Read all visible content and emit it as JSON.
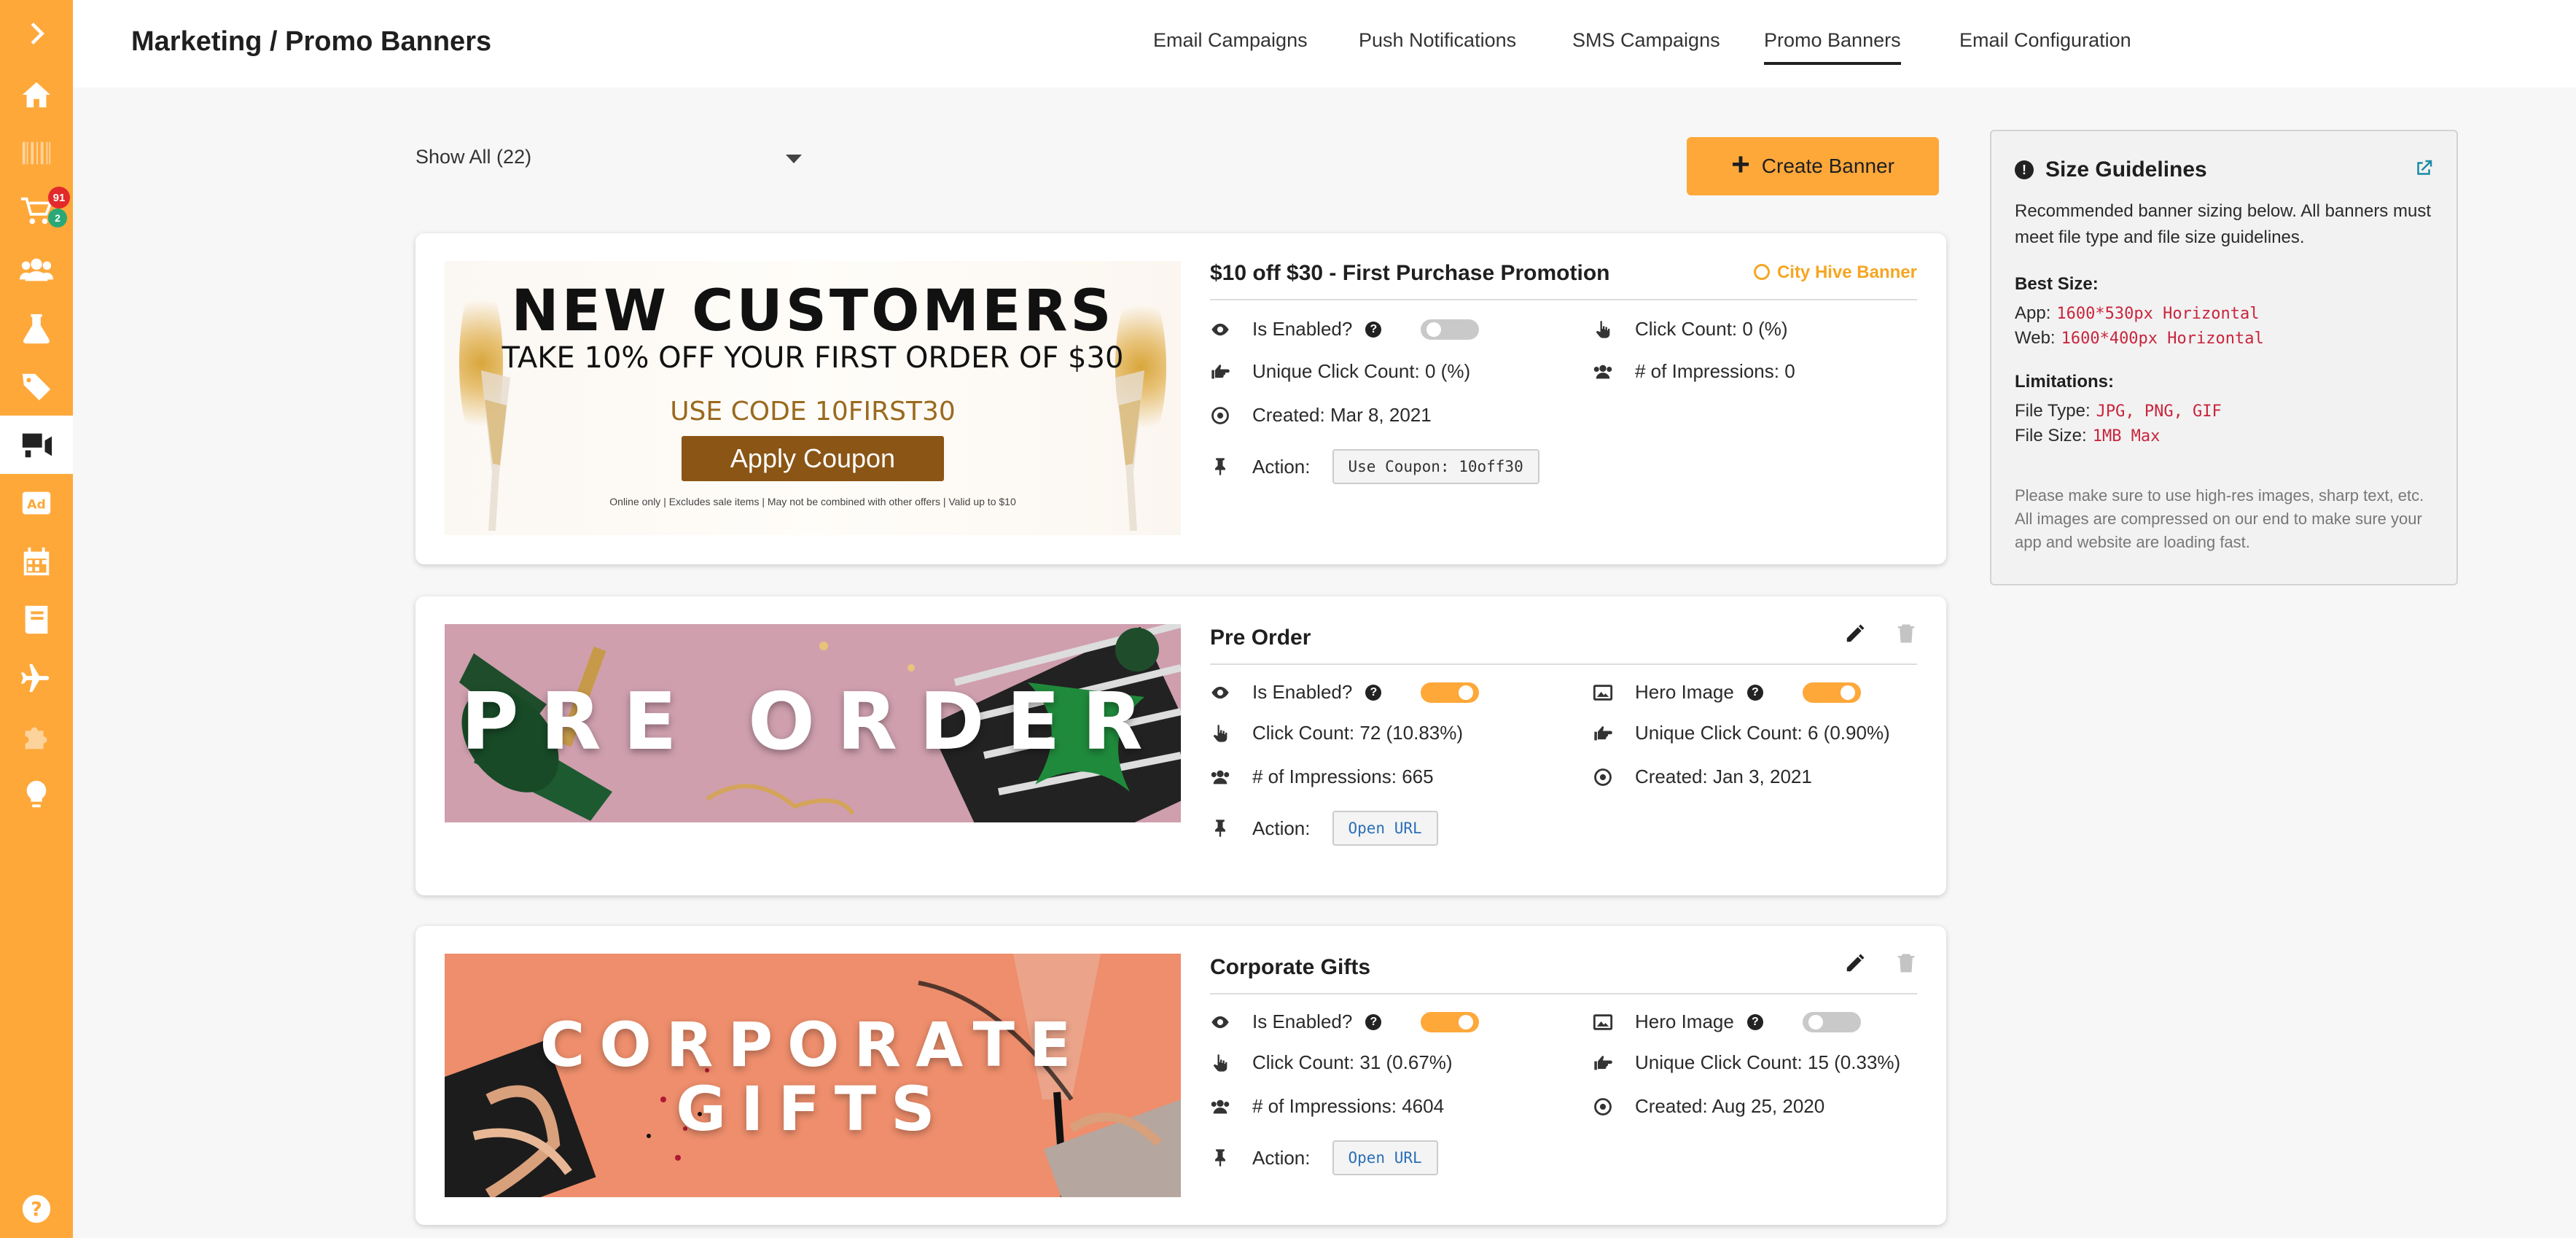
{
  "header": {
    "title": "Marketing / Promo Banners",
    "tabs": [
      {
        "label": "Email Campaigns"
      },
      {
        "label": "Push Notifications"
      },
      {
        "label": "SMS Campaigns"
      },
      {
        "label": "Promo Banners",
        "active": true
      },
      {
        "label": "Email Configuration"
      }
    ]
  },
  "sidebar": {
    "badges": {
      "cart_red": "91",
      "cart_green": "2"
    },
    "items": [
      "chevron-right-icon",
      "home-icon",
      "barcode-icon",
      "cart-icon",
      "users-icon",
      "flask-icon",
      "tags-icon",
      "marketing-icon",
      "ad-icon",
      "calendar-icon",
      "book-icon",
      "plane-icon",
      "puzzle-icon",
      "lightbulb-icon",
      "help-icon"
    ]
  },
  "toolbar": {
    "filter_value": "Show All (22)",
    "create_label": "Create Banner"
  },
  "labels": {
    "is_enabled": "Is Enabled?",
    "hero_image": "Hero Image",
    "action": "Action:"
  },
  "banners": [
    {
      "title": "$10 off $30 - First Purchase Promotion",
      "tag": "City Hive Banner",
      "enabled": false,
      "click_count": "Click Count: 0 (%)",
      "unique_click_count": "Unique Click Count: 0 (%)",
      "impressions": "# of Impressions: 0",
      "created": "Created: Mar 8, 2021",
      "action": "Use Coupon: 10off30",
      "image": {
        "line1": "NEW CUSTOMERS",
        "line2": "TAKE 10% OFF YOUR FIRST ORDER OF $30",
        "line3": "USE CODE 10FIRST30",
        "button": "Apply Coupon",
        "fineprint": "Online only | Excludes sale items | May not be combined with other offers | Valid up to $10"
      }
    },
    {
      "title": "Pre Order",
      "enabled": true,
      "hero_image": true,
      "click_count": "Click Count: 72 (10.83%)",
      "unique_click_count": "Unique Click Count: 6 (0.90%)",
      "impressions": "# of Impressions: 665",
      "created": "Created: Jan 3, 2021",
      "action": "Open URL",
      "image": {
        "text": "PRE ORDER"
      }
    },
    {
      "title": "Corporate Gifts",
      "enabled": true,
      "hero_image": false,
      "click_count": "Click Count: 31 (0.67%)",
      "unique_click_count": "Unique Click Count: 15 (0.33%)",
      "impressions": "# of Impressions: 4604",
      "created": "Created: Aug 25, 2020",
      "action": "Open URL",
      "image": {
        "line1": "CORPORATE",
        "line2": "GIFTS"
      }
    }
  ],
  "guidelines": {
    "title": "Size Guidelines",
    "intro": "Recommended banner sizing below. All banners must meet file type and file size guidelines.",
    "best_size_label": "Best Size:",
    "app_label": "App:",
    "app_value": "1600*530px Horizontal",
    "web_label": "Web:",
    "web_value": "1600*400px Horizontal",
    "limitations_label": "Limitations:",
    "file_type_label": "File Type:",
    "file_type_value": "JPG, PNG, GIF",
    "file_size_label": "File Size:",
    "file_size_value": "1MB Max",
    "note": "Please make sure to use high-res images, sharp text, etc. All images are compressed on our end to make sure your app and website are loading fast."
  },
  "colors": {
    "accent": "#fea83a",
    "code_red": "#c8253d",
    "link_blue": "#2a6fb8"
  }
}
